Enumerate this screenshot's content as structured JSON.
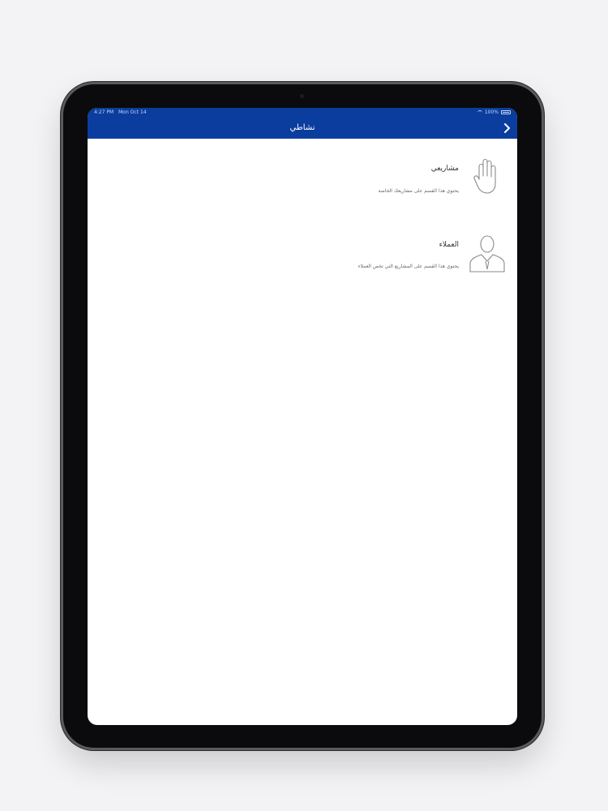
{
  "status_bar": {
    "time": "4:27 PM",
    "date": "Mon Oct 14",
    "battery": "100%"
  },
  "nav": {
    "title": "نشاطي"
  },
  "items": [
    {
      "title": "مشاريعي",
      "description": "يحتوي هذا القسم على مشاريعك الخاصة",
      "icon": "hand-icon"
    },
    {
      "title": "العملاء",
      "description": "يحتوي هذا القسم على المشاريع التي تخص العملاء",
      "icon": "person-icon"
    }
  ],
  "colors": {
    "header": "#0a3d9e",
    "background": "#ffffff"
  }
}
